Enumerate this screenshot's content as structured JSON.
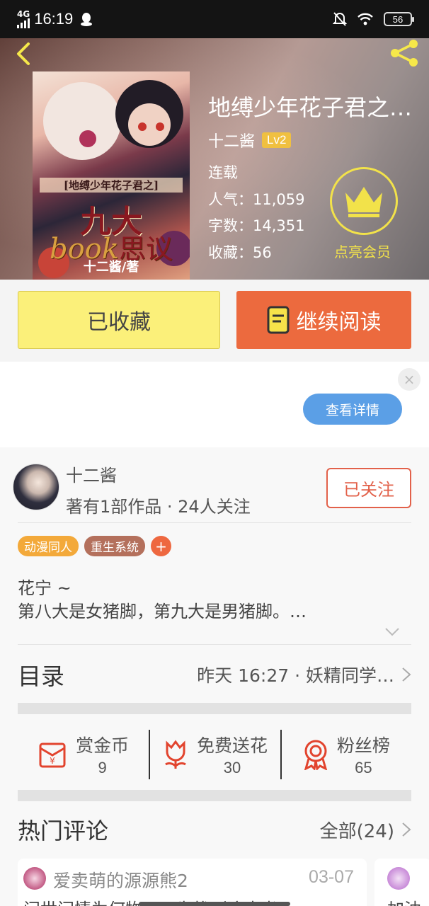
{
  "status_bar": {
    "network": "4G",
    "time": "16:19",
    "battery": "56"
  },
  "book": {
    "cover": {
      "subtitle": "[地缚少年花子君之]",
      "main": "九大",
      "book_word": "book",
      "book_word2": "思议",
      "author": "十二酱/著"
    },
    "title": "地缚少年花子君之九大不可思议",
    "author": "十二酱",
    "level": "Lv2",
    "state": "连载",
    "popularity": "人气：11,059",
    "words": "字数：14,351",
    "favorites": "收藏：56"
  },
  "vip": {
    "label": "点亮会员"
  },
  "buttons": {
    "favorite": "已收藏",
    "continue_read": "继续阅读"
  },
  "ad": {
    "close": "×",
    "detail": "查看详情"
  },
  "author_card": {
    "name": "十二酱",
    "meta": "著有1部作品 · 24人关注",
    "follow": "已关注"
  },
  "tags": [
    "动漫同人",
    "重生系统",
    "+"
  ],
  "description": {
    "line1": "花宁 ~",
    "line2": "第八大是女猪脚，第九大是男猪脚。…"
  },
  "toc": {
    "label": "目录",
    "latest": "昨天 16:27 · 妖精同学…"
  },
  "actions": [
    {
      "label": "赏金币",
      "value": "9",
      "icon": "red-envelope-icon"
    },
    {
      "label": "免费送花",
      "value": "30",
      "icon": "flower-icon"
    },
    {
      "label": "粉丝榜",
      "value": "65",
      "icon": "medal-icon"
    }
  ],
  "hot_comments": {
    "title": "热门评论",
    "all": "全部(24)",
    "items": [
      {
        "user": "爱卖萌的源源熊2",
        "date": "03-07",
        "text": "问世间情为何物，只为找到这本书(・"
      },
      {
        "user": "",
        "date": "",
        "text": "加油"
      }
    ]
  },
  "colors": {
    "accent_orange": "#ec6a3e",
    "favorite_yellow": "#fbf07a",
    "vip_yellow": "#f2e24a",
    "link_blue": "#5b9fe6"
  }
}
